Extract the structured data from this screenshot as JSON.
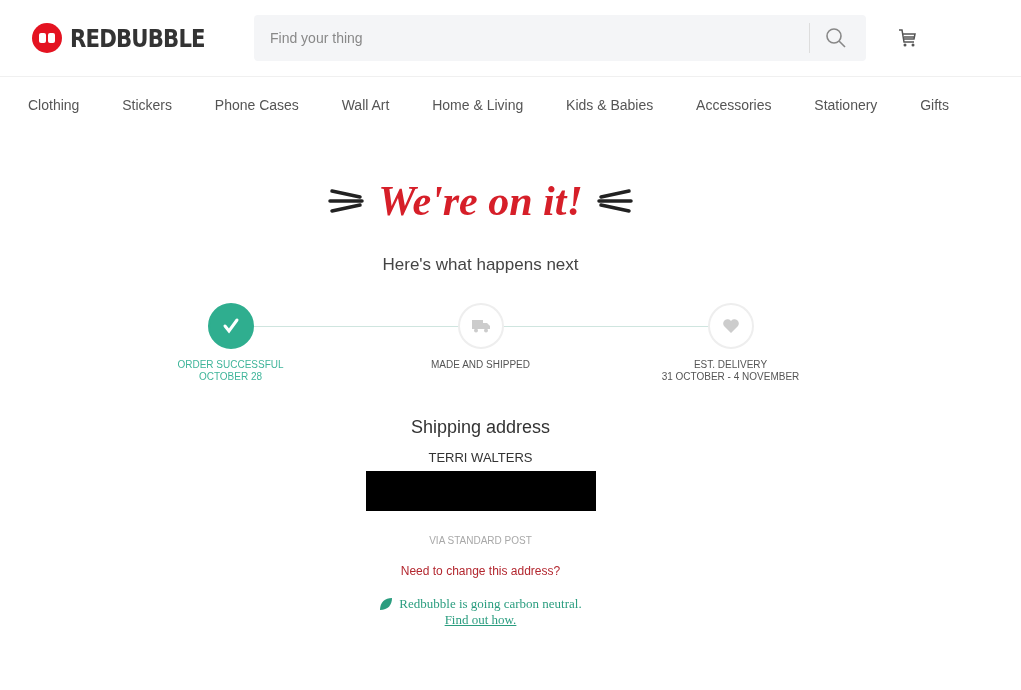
{
  "header": {
    "logo": "REDBUBBLE",
    "search": {
      "placeholder": "Find your thing"
    }
  },
  "nav": [
    "Clothing",
    "Stickers",
    "Phone Cases",
    "Wall Art",
    "Home & Living",
    "Kids & Babies",
    "Accessories",
    "Stationery",
    "Gifts"
  ],
  "headline": "We're on it!",
  "subtitle": "Here's what happens next",
  "steps": [
    {
      "kind": "check",
      "done": true,
      "lines": [
        "ORDER SUCCESSFUL",
        "OCTOBER 28"
      ]
    },
    {
      "kind": "truck",
      "done": false,
      "lines": [
        "MADE AND SHIPPED"
      ]
    },
    {
      "kind": "heart",
      "done": false,
      "lines": [
        "EST. DELIVERY",
        "31 OCTOBER - 4 NOVEMBER"
      ]
    }
  ],
  "shipping": {
    "title": "Shipping address",
    "name": "TERRI WALTERS",
    "method": "VIA STANDARD POST",
    "change_link": "Need to change this address?"
  },
  "carbon": {
    "text": "Redbubble is going carbon neutral.",
    "link": "Find out how."
  }
}
